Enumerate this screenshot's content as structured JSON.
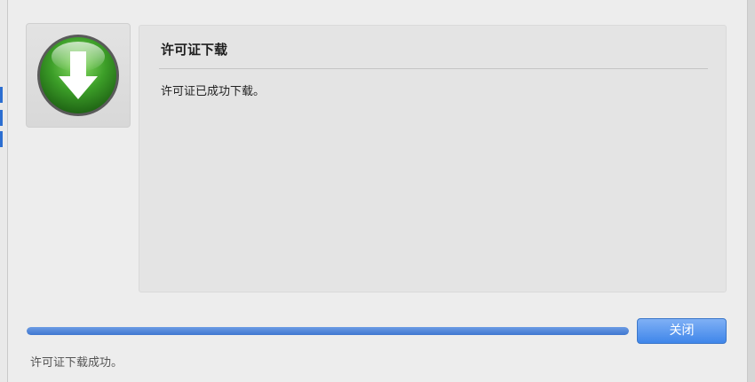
{
  "dialog": {
    "icon": "download-arrow-icon",
    "panel": {
      "title": "许可证下载",
      "message": "许可证已成功下载。"
    },
    "progress": {
      "percent": 100
    },
    "close_label": "关闭",
    "status": "许可证下载成功。"
  },
  "colors": {
    "accent": "#3f86ea",
    "icon_green": "#3c9e28"
  }
}
